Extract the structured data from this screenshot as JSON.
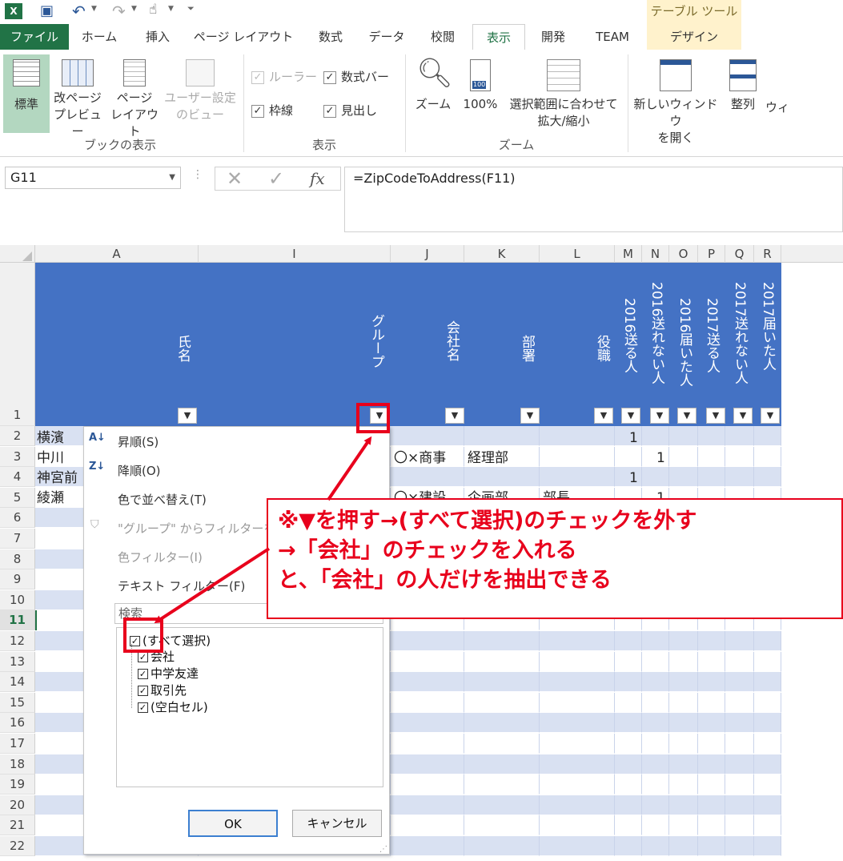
{
  "qat": {
    "icons": [
      "excel-icon",
      "save-icon",
      "undo-icon",
      "redo-icon",
      "touch-icon",
      "customize-icon"
    ]
  },
  "tabs": [
    "ファイル",
    "ホーム",
    "挿入",
    "ページ レイアウト",
    "数式",
    "データ",
    "校閲",
    "表示",
    "開発",
    "TEAM",
    "デザイン"
  ],
  "active_tab": "表示",
  "table_tools": "テーブル ツール",
  "ribbon": {
    "view_group": {
      "label": "ブックの表示",
      "normal": "標準",
      "page_break_1": "改ページ",
      "page_break_2": "プレビュー",
      "page_layout_1": "ページ",
      "page_layout_2": "レイアウト",
      "custom_1": "ユーザー設定",
      "custom_2": "のビュー"
    },
    "show_group": {
      "label": "表示",
      "ruler": "ルーラー",
      "formula_bar": "数式バー",
      "gridlines": "枠線",
      "headings": "見出し"
    },
    "zoom_group": {
      "label": "ズーム",
      "zoom": "ズーム",
      "zoom100": "100%",
      "fit_1": "選択範囲に合わせて",
      "fit_2": "拡大/縮小"
    },
    "window_group": {
      "new_1": "新しいウィンドウ",
      "new_2": "を開く",
      "arrange": "整列",
      "more": "ウィ"
    }
  },
  "formula": {
    "name_box": "G11",
    "content": "=ZipCodeToAddress(F11)"
  },
  "columns": {
    "A": "A",
    "I": "I",
    "J": "J",
    "K": "K",
    "L": "L",
    "M": "M",
    "N": "N",
    "O": "O",
    "P": "P",
    "Q": "Q",
    "R": "R"
  },
  "headers": {
    "name": "氏名",
    "group": "グループ",
    "company": "会社名",
    "dept": "部署",
    "title": "役職",
    "m": "2016送る人",
    "n": "2016送れない人",
    "o": "2016届いた人",
    "p": "2017送る人",
    "q": "2017送れない人",
    "r": "2017届いた人"
  },
  "row_numbers": [
    "1",
    "2",
    "3",
    "4",
    "5",
    "6",
    "7",
    "8",
    "9",
    "10",
    "11",
    "12",
    "13",
    "14",
    "15",
    "16",
    "17",
    "18",
    "19",
    "20",
    "21",
    "22"
  ],
  "rows": {
    "r2": {
      "a": "横濱",
      "m": "1"
    },
    "r3": {
      "a": "中川",
      "j": "〇×商事",
      "k": "経理部",
      "n": "1"
    },
    "r4": {
      "a": "神宮前",
      "m": "1"
    },
    "r5": {
      "a": "綾瀬",
      "j": "〇×建設",
      "k": "企画部",
      "l": "部長",
      "n": "1"
    }
  },
  "menu": {
    "asc": "昇順(S)",
    "desc": "降順(O)",
    "color_sort": "色で並べ替え(T)",
    "clear": "\"グループ\" からフィルターをク",
    "color_filter": "色フィルター(I)",
    "text_filter": "テキスト フィルター(F)",
    "search": "検索",
    "items": [
      "(すべて選択)",
      "会社",
      "中学友達",
      "取引先",
      "(空白セル)"
    ],
    "ok": "OK",
    "cancel": "キャンセル"
  },
  "annotation": {
    "line1": "※▼を押す→(すべて選択)のチェックを外す",
    "line2": "→「会社」のチェックを入れる",
    "line3": "と、「会社」の人だけを抽出できる"
  }
}
